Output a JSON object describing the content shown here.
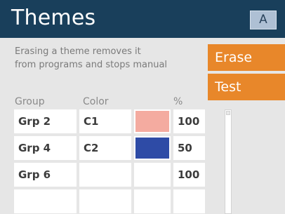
{
  "header": {
    "title": "Themes",
    "corner_button": "A"
  },
  "message": {
    "line1": "Erasing a theme removes it",
    "line2": "from programs and stops manual"
  },
  "buttons": {
    "erase": "Erase",
    "test": "Test"
  },
  "table": {
    "columns": {
      "group": "Group",
      "color": "Color",
      "percent": "%"
    },
    "rows": [
      {
        "group": "Grp 2",
        "color": "C1",
        "swatch": "#f4aba0",
        "percent": "100"
      },
      {
        "group": "Grp 4",
        "color": "C2",
        "swatch": "#2e4ba6",
        "percent": "50"
      },
      {
        "group": "Grp 6",
        "color": "",
        "swatch": "",
        "percent": "100"
      },
      {
        "group": "",
        "color": "",
        "swatch": "",
        "percent": ""
      }
    ]
  },
  "colors": {
    "header_bg": "#193f5b",
    "accent": "#e8872a",
    "background": "#e6e6e6"
  }
}
